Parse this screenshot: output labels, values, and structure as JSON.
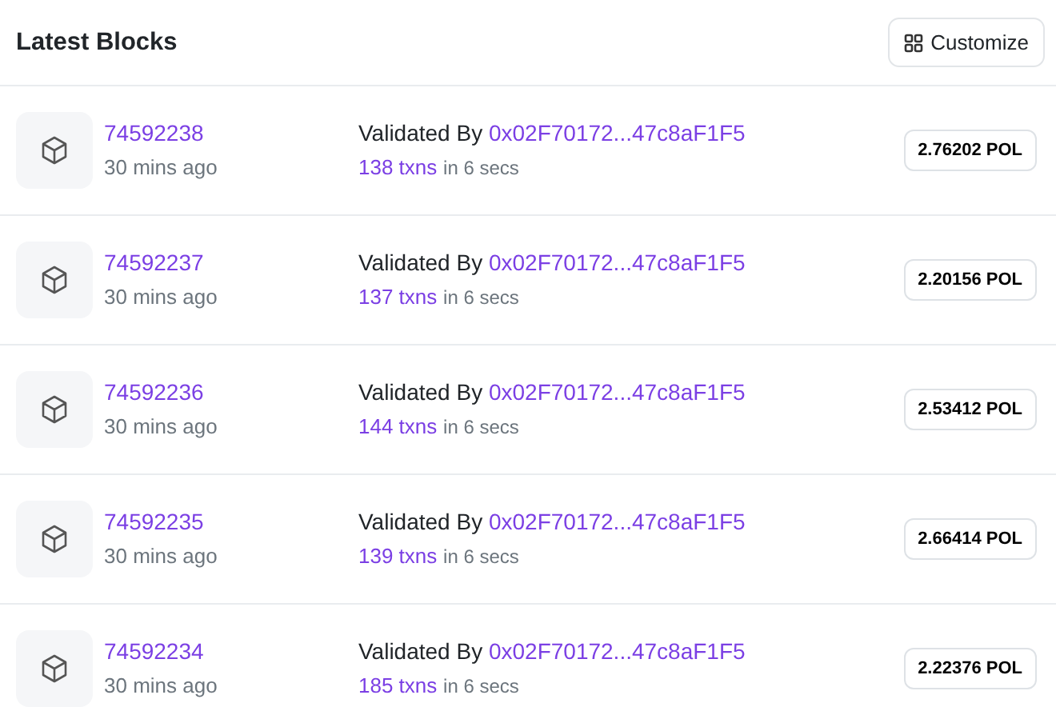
{
  "title": "Latest Blocks",
  "customize_button": "Customize",
  "blocks": [
    {
      "number": "74592238",
      "age": "30 mins ago",
      "validated_label": "Validated By",
      "validator": "0x02F70172...47c8aF1F5",
      "txns": "138 txns",
      "duration": "in 6 secs",
      "reward": "2.76202 POL"
    },
    {
      "number": "74592237",
      "age": "30 mins ago",
      "validated_label": "Validated By",
      "validator": "0x02F70172...47c8aF1F5",
      "txns": "137 txns",
      "duration": "in 6 secs",
      "reward": "2.20156 POL"
    },
    {
      "number": "74592236",
      "age": "30 mins ago",
      "validated_label": "Validated By",
      "validator": "0x02F70172...47c8aF1F5",
      "txns": "144 txns",
      "duration": "in 6 secs",
      "reward": "2.53412 POL"
    },
    {
      "number": "74592235",
      "age": "30 mins ago",
      "validated_label": "Validated By",
      "validator": "0x02F70172...47c8aF1F5",
      "txns": "139 txns",
      "duration": "in 6 secs",
      "reward": "2.66414 POL"
    },
    {
      "number": "74592234",
      "age": "30 mins ago",
      "validated_label": "Validated By",
      "validator": "0x02F70172...47c8aF1F5",
      "txns": "185 txns",
      "duration": "in 6 secs",
      "reward": "2.22376 POL"
    }
  ]
}
